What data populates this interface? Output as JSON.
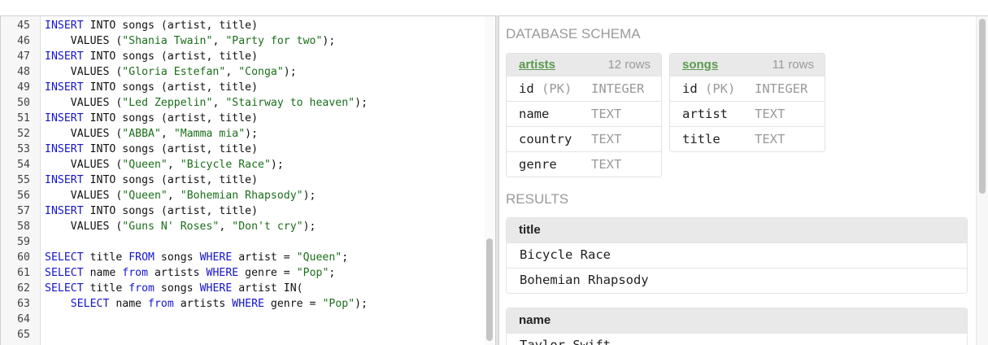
{
  "editor": {
    "lines": [
      {
        "num": "45",
        "tokens": [
          {
            "t": "INSERT",
            "k": "kw"
          },
          {
            "t": " INTO songs (artist, title)",
            "k": ""
          }
        ]
      },
      {
        "num": "46",
        "tokens": [
          {
            "t": "    VALUES (",
            "k": ""
          },
          {
            "t": "\"Shania Twain\"",
            "k": "str"
          },
          {
            "t": ", ",
            "k": ""
          },
          {
            "t": "\"Party for two\"",
            "k": "str"
          },
          {
            "t": ");",
            "k": ""
          }
        ]
      },
      {
        "num": "47",
        "tokens": [
          {
            "t": "INSERT",
            "k": "kw"
          },
          {
            "t": " INTO songs (artist, title)",
            "k": ""
          }
        ]
      },
      {
        "num": "48",
        "tokens": [
          {
            "t": "    VALUES (",
            "k": ""
          },
          {
            "t": "\"Gloria Estefan\"",
            "k": "str"
          },
          {
            "t": ", ",
            "k": ""
          },
          {
            "t": "\"Conga\"",
            "k": "str"
          },
          {
            "t": ");",
            "k": ""
          }
        ]
      },
      {
        "num": "49",
        "tokens": [
          {
            "t": "INSERT",
            "k": "kw"
          },
          {
            "t": " INTO songs (artist, title)",
            "k": ""
          }
        ]
      },
      {
        "num": "50",
        "tokens": [
          {
            "t": "    VALUES (",
            "k": ""
          },
          {
            "t": "\"Led Zeppelin\"",
            "k": "str"
          },
          {
            "t": ", ",
            "k": ""
          },
          {
            "t": "\"Stairway to heaven\"",
            "k": "str"
          },
          {
            "t": ");",
            "k": ""
          }
        ]
      },
      {
        "num": "51",
        "tokens": [
          {
            "t": "INSERT",
            "k": "kw"
          },
          {
            "t": " INTO songs (artist, title)",
            "k": ""
          }
        ]
      },
      {
        "num": "52",
        "tokens": [
          {
            "t": "    VALUES (",
            "k": ""
          },
          {
            "t": "\"ABBA\"",
            "k": "str"
          },
          {
            "t": ", ",
            "k": ""
          },
          {
            "t": "\"Mamma mia\"",
            "k": "str"
          },
          {
            "t": ");",
            "k": ""
          }
        ]
      },
      {
        "num": "53",
        "tokens": [
          {
            "t": "INSERT",
            "k": "kw"
          },
          {
            "t": " INTO songs (artist, title)",
            "k": ""
          }
        ]
      },
      {
        "num": "54",
        "tokens": [
          {
            "t": "    VALUES (",
            "k": ""
          },
          {
            "t": "\"Queen\"",
            "k": "str"
          },
          {
            "t": ", ",
            "k": ""
          },
          {
            "t": "\"Bicycle Race\"",
            "k": "str"
          },
          {
            "t": ");",
            "k": ""
          }
        ]
      },
      {
        "num": "55",
        "tokens": [
          {
            "t": "INSERT",
            "k": "kw"
          },
          {
            "t": " INTO songs (artist, title)",
            "k": ""
          }
        ]
      },
      {
        "num": "56",
        "tokens": [
          {
            "t": "    VALUES (",
            "k": ""
          },
          {
            "t": "\"Queen\"",
            "k": "str"
          },
          {
            "t": ", ",
            "k": ""
          },
          {
            "t": "\"Bohemian Rhapsody\"",
            "k": "str"
          },
          {
            "t": ");",
            "k": ""
          }
        ]
      },
      {
        "num": "57",
        "tokens": [
          {
            "t": "INSERT",
            "k": "kw"
          },
          {
            "t": " INTO songs (artist, title)",
            "k": ""
          }
        ]
      },
      {
        "num": "58",
        "tokens": [
          {
            "t": "    VALUES (",
            "k": ""
          },
          {
            "t": "\"Guns N' Roses\"",
            "k": "str"
          },
          {
            "t": ", ",
            "k": ""
          },
          {
            "t": "\"Don't cry\"",
            "k": "str"
          },
          {
            "t": ");",
            "k": ""
          }
        ]
      },
      {
        "num": "59",
        "tokens": []
      },
      {
        "num": "60",
        "tokens": [
          {
            "t": "SELECT",
            "k": "kw"
          },
          {
            "t": " title ",
            "k": ""
          },
          {
            "t": "FROM",
            "k": "kw"
          },
          {
            "t": " songs ",
            "k": ""
          },
          {
            "t": "WHERE",
            "k": "kw"
          },
          {
            "t": " artist = ",
            "k": ""
          },
          {
            "t": "\"Queen\"",
            "k": "str"
          },
          {
            "t": ";",
            "k": ""
          }
        ]
      },
      {
        "num": "61",
        "tokens": [
          {
            "t": "SELECT",
            "k": "kw"
          },
          {
            "t": " name ",
            "k": ""
          },
          {
            "t": "from",
            "k": "kw"
          },
          {
            "t": " artists ",
            "k": ""
          },
          {
            "t": "WHERE",
            "k": "kw"
          },
          {
            "t": " genre = ",
            "k": ""
          },
          {
            "t": "\"Pop\"",
            "k": "str"
          },
          {
            "t": ";",
            "k": ""
          }
        ]
      },
      {
        "num": "62",
        "tokens": [
          {
            "t": "SELECT",
            "k": "kw"
          },
          {
            "t": " title ",
            "k": ""
          },
          {
            "t": "from",
            "k": "kw"
          },
          {
            "t": " songs ",
            "k": ""
          },
          {
            "t": "WHERE",
            "k": "kw"
          },
          {
            "t": " artist IN(",
            "k": ""
          }
        ]
      },
      {
        "num": "63",
        "tokens": [
          {
            "t": "    ",
            "k": ""
          },
          {
            "t": "SELECT",
            "k": "kw"
          },
          {
            "t": " name ",
            "k": ""
          },
          {
            "t": "from",
            "k": "kw"
          },
          {
            "t": " artists ",
            "k": ""
          },
          {
            "t": "WHERE",
            "k": "kw"
          },
          {
            "t": " genre = ",
            "k": ""
          },
          {
            "t": "\"Pop\"",
            "k": "str"
          },
          {
            "t": ");",
            "k": ""
          }
        ]
      },
      {
        "num": "64",
        "tokens": []
      },
      {
        "num": "65",
        "tokens": []
      }
    ]
  },
  "schema": {
    "heading": "DATABASE SCHEMA",
    "tables": [
      {
        "name": "artists",
        "count": "12 rows",
        "columns": [
          {
            "name": "id",
            "pk": "(PK)",
            "type": "INTEGER"
          },
          {
            "name": "name",
            "pk": "",
            "type": "TEXT"
          },
          {
            "name": "country",
            "pk": "",
            "type": "TEXT"
          },
          {
            "name": "genre",
            "pk": "",
            "type": "TEXT"
          }
        ]
      },
      {
        "name": "songs",
        "count": "11 rows",
        "columns": [
          {
            "name": "id",
            "pk": "(PK)",
            "type": "INTEGER"
          },
          {
            "name": "artist",
            "pk": "",
            "type": "TEXT"
          },
          {
            "name": "title",
            "pk": "",
            "type": "TEXT"
          }
        ]
      }
    ]
  },
  "results": {
    "heading": "RESULTS",
    "tables": [
      {
        "header": "title",
        "rows": [
          "Bicycle Race",
          "Bohemian Rhapsody"
        ]
      },
      {
        "header": "name",
        "rows": [
          "Taylor Swift"
        ]
      }
    ]
  },
  "colors": {
    "keyword": "#1515cc",
    "string": "#1a6f1a",
    "table_link": "#5a9a4e"
  }
}
